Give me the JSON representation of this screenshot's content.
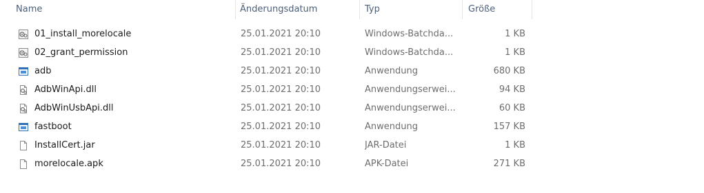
{
  "columns": {
    "name": "Name",
    "date": "Änderungsdatum",
    "type": "Typ",
    "size": "Größe"
  },
  "files": [
    {
      "icon": "batch-file-icon",
      "name": "01_install_morelocale",
      "date": "25.01.2021 20:10",
      "type": "Windows-Batchda...",
      "size": "1 KB"
    },
    {
      "icon": "batch-file-icon",
      "name": "02_grant_permission",
      "date": "25.01.2021 20:10",
      "type": "Windows-Batchda...",
      "size": "1 KB"
    },
    {
      "icon": "application-icon",
      "name": "adb",
      "date": "25.01.2021 20:10",
      "type": "Anwendung",
      "size": "680 KB"
    },
    {
      "icon": "dll-file-icon",
      "name": "AdbWinApi.dll",
      "date": "25.01.2021 20:10",
      "type": "Anwendungserwei...",
      "size": "94 KB"
    },
    {
      "icon": "dll-file-icon",
      "name": "AdbWinUsbApi.dll",
      "date": "25.01.2021 20:10",
      "type": "Anwendungserwei...",
      "size": "60 KB"
    },
    {
      "icon": "application-icon",
      "name": "fastboot",
      "date": "25.01.2021 20:10",
      "type": "Anwendung",
      "size": "157 KB"
    },
    {
      "icon": "blank-file-icon",
      "name": "InstallCert.jar",
      "date": "25.01.2021 20:10",
      "type": "JAR-Datei",
      "size": "1 KB"
    },
    {
      "icon": "blank-file-icon",
      "name": "morelocale.apk",
      "date": "25.01.2021 20:10",
      "type": "APK-Datei",
      "size": "271 KB"
    }
  ]
}
